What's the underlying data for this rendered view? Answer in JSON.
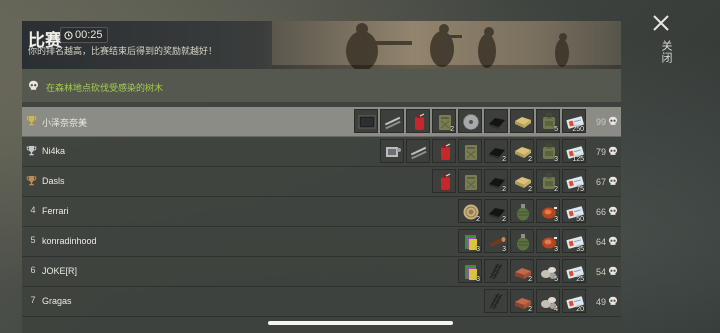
{
  "header": {
    "title": "比赛",
    "timer": "00:25",
    "subtitle": "你的排名越高，比赛结束后得到的奖励就越好！"
  },
  "info": {
    "text": "在森林地点砍伐受感染的树木"
  },
  "close": {
    "label": "关闭"
  },
  "colors": {
    "info_text": "#a6cf4a",
    "highlight_row": "#8a8c85"
  },
  "rows": [
    {
      "rank": "1",
      "trophy": "gold",
      "name": "小泽奈奈美",
      "score": "99",
      "items": [
        {
          "icon": "metal-plate-icon",
          "count": ""
        },
        {
          "icon": "pipes-icon",
          "count": ""
        },
        {
          "icon": "red-fuel-can-icon",
          "count": ""
        },
        {
          "icon": "jerrycan-icon",
          "count": "2"
        },
        {
          "icon": "saw-blade-icon",
          "count": ""
        },
        {
          "icon": "rubber-icon",
          "count": ""
        },
        {
          "icon": "planks-icon",
          "count": ""
        },
        {
          "icon": "backpack-icon",
          "count": "5"
        },
        {
          "icon": "ticket-icon",
          "count": "250"
        }
      ]
    },
    {
      "rank": "2",
      "trophy": "silver",
      "name": "Ni4ka",
      "score": "79",
      "items": [
        {
          "icon": "engine-part-icon",
          "count": ""
        },
        {
          "icon": "pipes-icon",
          "count": ""
        },
        {
          "icon": "red-fuel-can-icon",
          "count": ""
        },
        {
          "icon": "jerrycan-icon",
          "count": ""
        },
        {
          "icon": "rubber-icon",
          "count": "2"
        },
        {
          "icon": "planks-icon",
          "count": "2"
        },
        {
          "icon": "backpack-icon",
          "count": "3"
        },
        {
          "icon": "ticket-icon",
          "count": "125"
        }
      ]
    },
    {
      "rank": "3",
      "trophy": "bronze",
      "name": "Dasls",
      "score": "67",
      "items": [
        {
          "icon": "red-fuel-can-icon",
          "count": ""
        },
        {
          "icon": "jerrycan-icon",
          "count": ""
        },
        {
          "icon": "rubber-icon",
          "count": "2"
        },
        {
          "icon": "planks-icon",
          "count": "2"
        },
        {
          "icon": "backpack-icon",
          "count": "2"
        },
        {
          "icon": "ticket-icon",
          "count": "75"
        }
      ]
    },
    {
      "rank": "4",
      "trophy": "",
      "name": "Ferrari",
      "score": "66",
      "items": [
        {
          "icon": "rope-coil-icon",
          "count": "2"
        },
        {
          "icon": "rubber-icon",
          "count": "2"
        },
        {
          "icon": "grenade-icon",
          "count": ""
        },
        {
          "icon": "meat-icon",
          "count": "3"
        },
        {
          "icon": "ticket-icon",
          "count": "50"
        }
      ]
    },
    {
      "rank": "5",
      "trophy": "",
      "name": "konradinhood",
      "score": "64",
      "items": [
        {
          "icon": "book-icon",
          "count": "3"
        },
        {
          "icon": "wood-log-icon",
          "count": "3"
        },
        {
          "icon": "grenade-icon",
          "count": ""
        },
        {
          "icon": "meat-icon",
          "count": "3"
        },
        {
          "icon": "ticket-icon",
          "count": "35"
        }
      ]
    },
    {
      "rank": "6",
      "trophy": "",
      "name": "JOKE[R]",
      "score": "54",
      "items": [
        {
          "icon": "book-icon",
          "count": "3"
        },
        {
          "icon": "spring-icon",
          "count": ""
        },
        {
          "icon": "brick-icon",
          "count": "2"
        },
        {
          "icon": "stones-icon",
          "count": "5"
        },
        {
          "icon": "ticket-icon",
          "count": "25"
        }
      ]
    },
    {
      "rank": "7",
      "trophy": "",
      "name": "Gragas",
      "score": "49",
      "items": [
        {
          "icon": "spring-icon",
          "count": ""
        },
        {
          "icon": "brick-icon",
          "count": "2"
        },
        {
          "icon": "stones-icon",
          "count": "4"
        },
        {
          "icon": "ticket-icon",
          "count": "20"
        }
      ]
    }
  ]
}
